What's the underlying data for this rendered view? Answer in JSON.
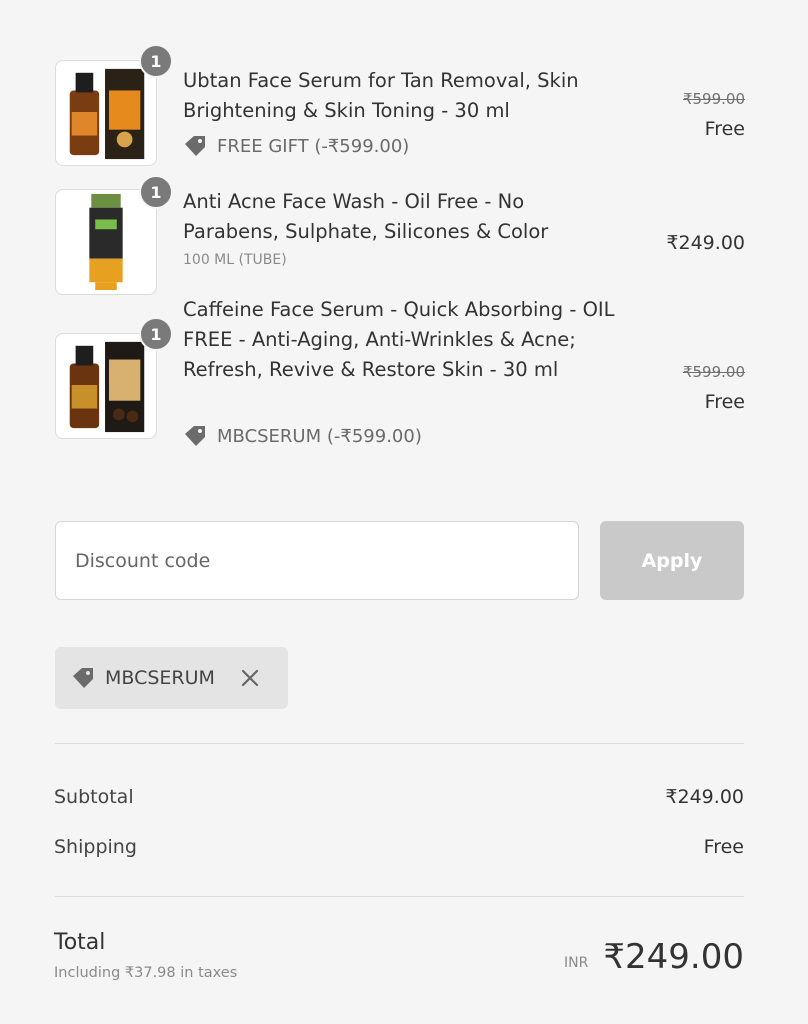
{
  "items": [
    {
      "name": "Ubtan Face Serum for Tan Removal, Skin Brightening & Skin Toning - 30 ml",
      "quantity": "1",
      "discount_label": "FREE GIFT (-₹599.00)",
      "original_price": "₹599.00",
      "price": "Free",
      "image_icon": "serum-bottle-icon"
    },
    {
      "name": "Anti Acne Face Wash - Oil Free - No Parabens, Sulphate, Silicones & Color",
      "quantity": "1",
      "variant": "100 ML (TUBE)",
      "price": "₹249.00",
      "image_icon": "face-wash-tube-icon"
    },
    {
      "name": "Caffeine Face Serum - Quick Absorbing - OIL FREE - Anti-Aging, Anti-Wrinkles & Acne; Refresh, Revive & Restore Skin - 30 ml",
      "quantity": "1",
      "discount_label": "MBCSERUM (-₹599.00)",
      "original_price": "₹599.00",
      "price": "Free",
      "image_icon": "serum-bottle-icon"
    }
  ],
  "discount": {
    "placeholder": "Discount code",
    "value": "",
    "apply_label": "Apply",
    "applied_code": "MBCSERUM"
  },
  "summary": {
    "subtotal_label": "Subtotal",
    "subtotal_value": "₹249.00",
    "shipping_label": "Shipping",
    "shipping_value": "Free",
    "total_label": "Total",
    "tax_note": "Including ₹37.98 in taxes",
    "currency": "INR",
    "total_value": "₹249.00"
  },
  "colors": {
    "background": "#f5f5f5",
    "qty_badge": "#7a7a7a",
    "apply_disabled": "#c9c9c9",
    "chip_bg": "#e4e4e4"
  }
}
